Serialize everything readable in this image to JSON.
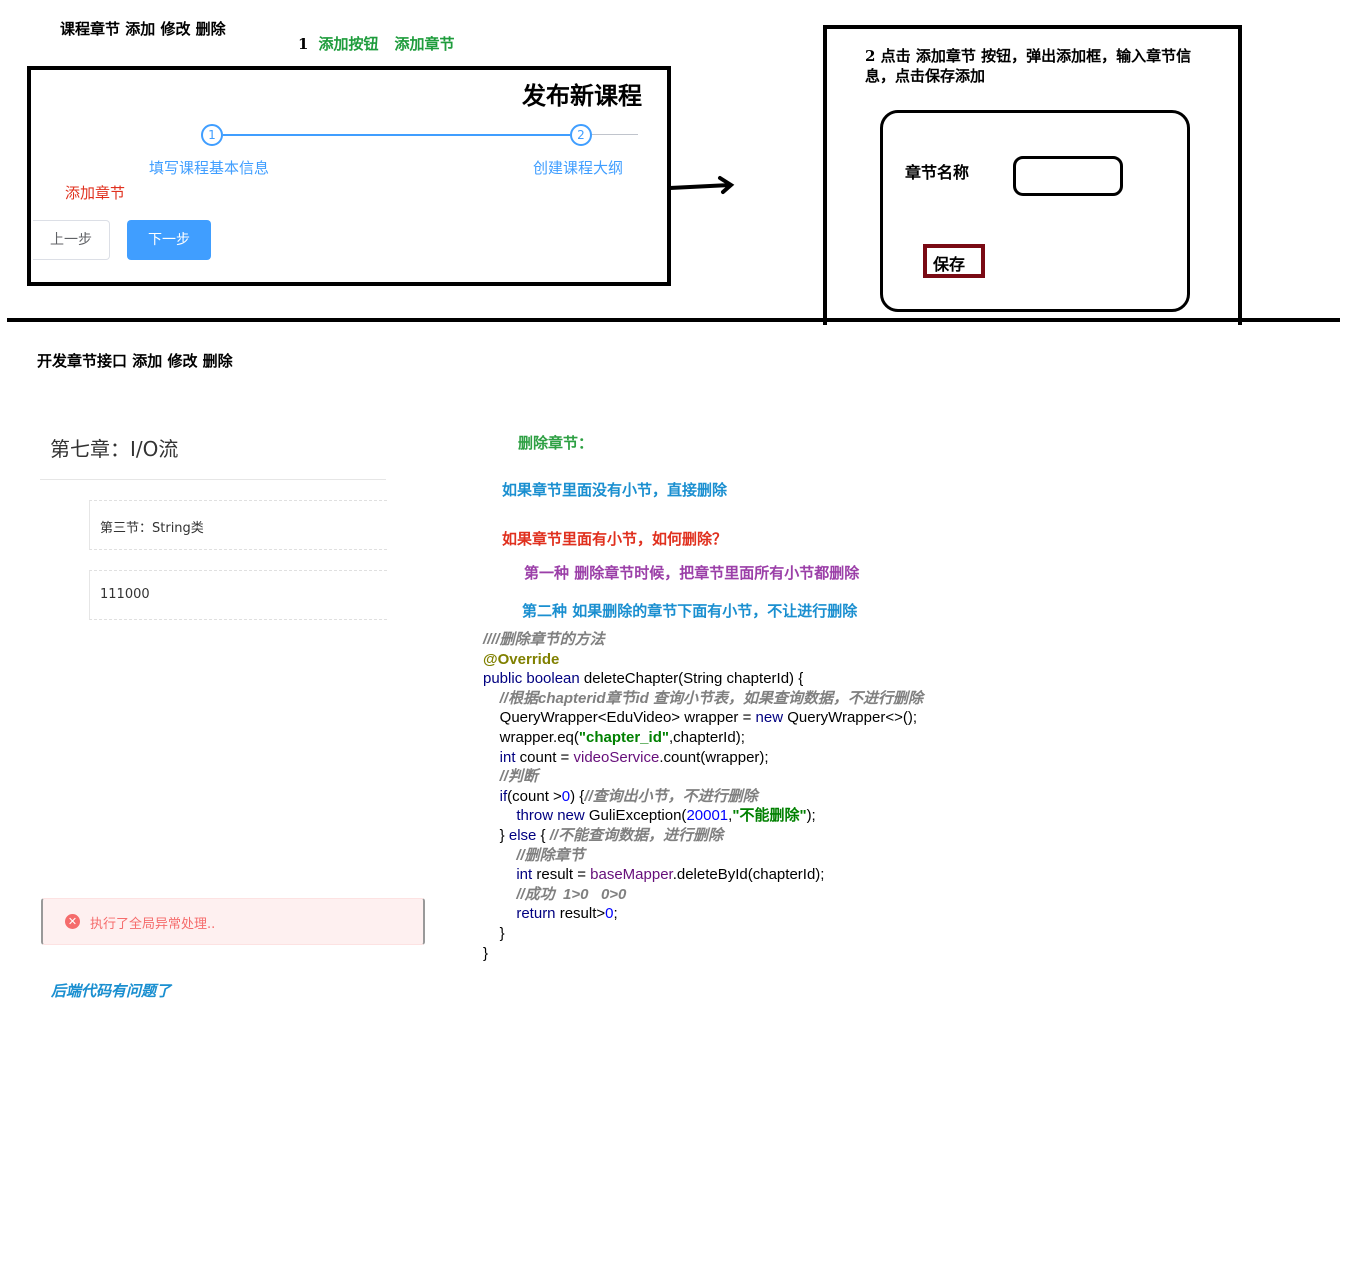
{
  "headings": {
    "top": "课程章节  添加  修改  删除",
    "step1_num": "1",
    "step1_a": "添加按钮",
    "step1_b": "添加章节",
    "bottom": "开发章节接口  添加  修改  删除"
  },
  "panel": {
    "title": "发布新课程",
    "step1_num": "1",
    "step2_num": "2",
    "step1_label": "填写课程基本信息",
    "step2_label": "创建课程大纲",
    "add_chapter": "添加章节",
    "prev": "上一步",
    "next": "下一步"
  },
  "dialog": {
    "step2_text": "2 点击 添加章节 按钮，弹出添加框，输入章节信息，点击保存添加",
    "chapter_name_label": "章节名称",
    "save": "保存"
  },
  "chapters": {
    "chapter": "第七章：I/O流",
    "section1": "第三节：String类",
    "section2": "111000"
  },
  "toast": {
    "text": "执行了全局异常处理.."
  },
  "backend_note": "后端代码有问题了",
  "delete_notes": {
    "title": "删除章节：",
    "line1": "如果章节里面没有小节，直接删除",
    "line2": "如果章节里面有小节，如何删除？",
    "line3": "第一种  删除章节时候，把章节里面所有小节都删除",
    "line4": "第二种  如果删除的章节下面有小节，不让进行删除"
  },
  "code": {
    "l1": "////删除章节的方法",
    "l2": "@Override",
    "l3a": "public boolean",
    "l3b": " deleteChapter(String chapterId) {",
    "l4": "    //根据chapterid章节id 查询小节表，如果查询数据，不进行删除",
    "l5a": "    QueryWrapper<EduVideo> wrapper = ",
    "l5b": "new",
    "l5c": " QueryWrapper<>();",
    "l6a": "    wrapper.eq(",
    "l6b": "\"chapter_id\"",
    "l6c": ",chapterId);",
    "l7a": "    ",
    "l7b": "int",
    "l7c": " count = ",
    "l7d": "videoService",
    "l7e": ".count(wrapper);",
    "l8": "    //判断",
    "l9a": "    ",
    "l9b": "if",
    "l9c": "(count >",
    "l9d": "0",
    "l9e": ") {",
    "l9f": "//查询出小节，不进行删除",
    "l10a": "        ",
    "l10b": "throw new",
    "l10c": " GuliException(",
    "l10d": "20001",
    "l10e": ",",
    "l10f": "\"不能删除\"",
    "l10g": ");",
    "l11a": "    } ",
    "l11b": "else",
    "l11c": " { ",
    "l11d": "//不能查询数据，进行删除",
    "l12": "        //删除章节",
    "l13a": "        ",
    "l13b": "int",
    "l13c": " result = ",
    "l13d": "baseMapper",
    "l13e": ".deleteById(chapterId);",
    "l14": "        //成功  1>0   0>0",
    "l15a": "        ",
    "l15b": "return",
    "l15c": " result>",
    "l15d": "0",
    "l15e": ";",
    "l16": "    }",
    "l17": "}"
  },
  "colors": {
    "primary": "#409eff",
    "green_note": "#2ea043",
    "red_note": "#e0301e",
    "purple_note": "#9b3fa8",
    "blue_note": "#1a8fd0",
    "error": "#f56c6c",
    "save_border": "#7a0a14"
  }
}
